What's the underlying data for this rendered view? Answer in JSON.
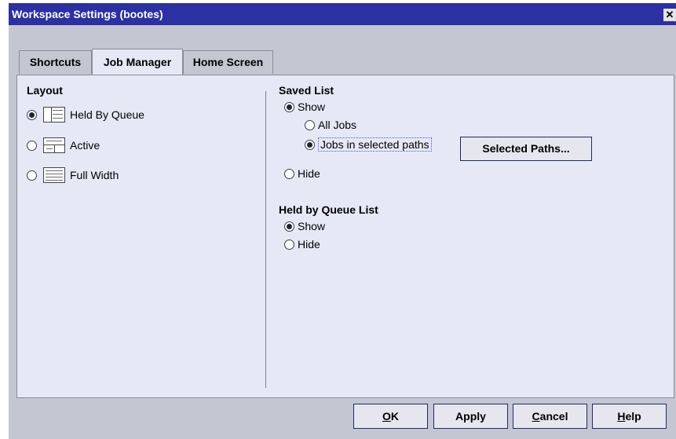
{
  "window": {
    "title": "Workspace Settings (bootes)",
    "close_glyph": "✕"
  },
  "tabs": [
    {
      "label": "Shortcuts",
      "active": false
    },
    {
      "label": "Job Manager",
      "active": true
    },
    {
      "label": "Home Screen",
      "active": false
    }
  ],
  "layout": {
    "heading": "Layout",
    "options": [
      {
        "label": "Held By Queue",
        "checked": true,
        "icon": "held-by-queue-layout-icon"
      },
      {
        "label": "Active",
        "checked": false,
        "icon": "active-layout-icon"
      },
      {
        "label": "Full Width",
        "checked": false,
        "icon": "full-width-layout-icon"
      }
    ]
  },
  "saved_list": {
    "heading": "Saved List",
    "show": "Show",
    "all_jobs": "All Jobs",
    "jobs_in_paths": "Jobs in selected paths",
    "selected_paths_button": "Selected Paths...",
    "hide": "Hide",
    "selected": "show",
    "scope": "jobs_in_paths"
  },
  "held_by_queue_list": {
    "heading": "Held by Queue List",
    "show": "Show",
    "hide": "Hide",
    "selected": "show"
  },
  "buttons": {
    "ok": {
      "mnemonic": "O",
      "rest": "K"
    },
    "apply": "Apply",
    "cancel": {
      "mnemonic": "C",
      "rest": "ancel"
    },
    "help": {
      "mnemonic": "H",
      "rest": "elp"
    }
  },
  "colors": {
    "title_bar": "#2b30a3",
    "dialog_bg": "#c4c6d1",
    "panel_bg": "#e7e8f5",
    "button_border": "#1c2a6b"
  }
}
